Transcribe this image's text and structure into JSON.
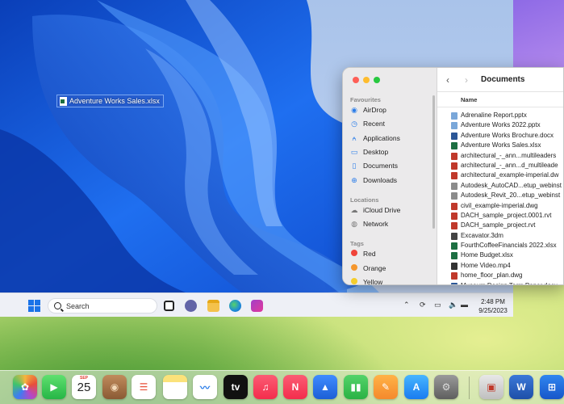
{
  "windows_vm": {
    "desktop_file_label": "Adventure Works Sales.xlsx",
    "taskbar": {
      "search_placeholder": "Search",
      "clock_time": "2:48 PM",
      "clock_date": "9/25/2023"
    }
  },
  "finder": {
    "title": "Documents",
    "column_name": "Name",
    "sidebar": {
      "favourites_header": "Favourites",
      "favourites": [
        {
          "label": "AirDrop",
          "icon": "airdrop-icon"
        },
        {
          "label": "Recent",
          "icon": "clock-icon"
        },
        {
          "label": "Applications",
          "icon": "applications-icon"
        },
        {
          "label": "Desktop",
          "icon": "desktop-icon"
        },
        {
          "label": "Documents",
          "icon": "document-icon"
        },
        {
          "label": "Downloads",
          "icon": "download-icon"
        }
      ],
      "locations_header": "Locations",
      "locations": [
        {
          "label": "iCloud Drive",
          "icon": "cloud-icon"
        },
        {
          "label": "Network",
          "icon": "globe-icon"
        }
      ],
      "tags_header": "Tags",
      "tags": [
        {
          "label": "Red",
          "color": "#f0443a"
        },
        {
          "label": "Orange",
          "color": "#f5962c"
        },
        {
          "label": "Yellow",
          "color": "#f5cd2c"
        }
      ]
    },
    "files": [
      {
        "name": "Adrenaline Report.pptx",
        "kind": "pptx",
        "color": "#7aa7d9"
      },
      {
        "name": "Adventure Works 2022.pptx",
        "kind": "pptx",
        "color": "#7aa7d9"
      },
      {
        "name": "Adventure Works Brochure.docx",
        "kind": "docx",
        "color": "#2b5797"
      },
      {
        "name": "Adventure Works Sales.xlsx",
        "kind": "xlsx",
        "color": "#1d6f42"
      },
      {
        "name": "architectural_-_ann...multileaders",
        "kind": "dwg",
        "color": "#c0392b"
      },
      {
        "name": "architectural_-_ann...d_multileade",
        "kind": "dwg",
        "color": "#c0392b"
      },
      {
        "name": "architectural_example-imperial.dw",
        "kind": "dwg",
        "color": "#c0392b"
      },
      {
        "name": "Autodesk_AutoCAD...etup_webinst",
        "kind": "app",
        "color": "#8c8c8c"
      },
      {
        "name": "Autodesk_Revit_20...etup_webinst",
        "kind": "app",
        "color": "#8c8c8c"
      },
      {
        "name": "civil_example-imperial.dwg",
        "kind": "dwg",
        "color": "#c0392b"
      },
      {
        "name": "DACH_sample_project.0001.rvt",
        "kind": "rvt",
        "color": "#c0392b"
      },
      {
        "name": "DACH_sample_project.rvt",
        "kind": "rvt",
        "color": "#c0392b"
      },
      {
        "name": "Excavator.3dm",
        "kind": "3dm",
        "color": "#444444"
      },
      {
        "name": "FourthCoffeeFinancials 2022.xlsx",
        "kind": "xlsx",
        "color": "#1d6f42"
      },
      {
        "name": "Home Budget.xlsx",
        "kind": "xlsx",
        "color": "#1d6f42"
      },
      {
        "name": "Home Video.mp4",
        "kind": "mp4",
        "color": "#333333"
      },
      {
        "name": "home_floor_plan.dwg",
        "kind": "dwg",
        "color": "#c0392b"
      },
      {
        "name": "Museum Design Term Paper.docx",
        "kind": "docx",
        "color": "#2b5797"
      }
    ]
  },
  "dock": {
    "calendar_month": "SEP",
    "calendar_day": "25",
    "apps": [
      {
        "name": "photos-icon"
      },
      {
        "name": "facetime-icon"
      },
      {
        "name": "calendar-icon"
      },
      {
        "name": "contacts-icon"
      },
      {
        "name": "reminders-icon"
      },
      {
        "name": "notes-icon"
      },
      {
        "name": "freeform-icon"
      },
      {
        "name": "apple-tv-icon"
      },
      {
        "name": "music-icon"
      },
      {
        "name": "news-icon"
      },
      {
        "name": "keynote-icon"
      },
      {
        "name": "numbers-icon"
      },
      {
        "name": "pages-icon"
      },
      {
        "name": "app-store-icon"
      },
      {
        "name": "system-settings-icon"
      },
      {
        "name": "remote-desktop-icon"
      },
      {
        "name": "word-icon"
      },
      {
        "name": "windows-icon"
      }
    ]
  }
}
